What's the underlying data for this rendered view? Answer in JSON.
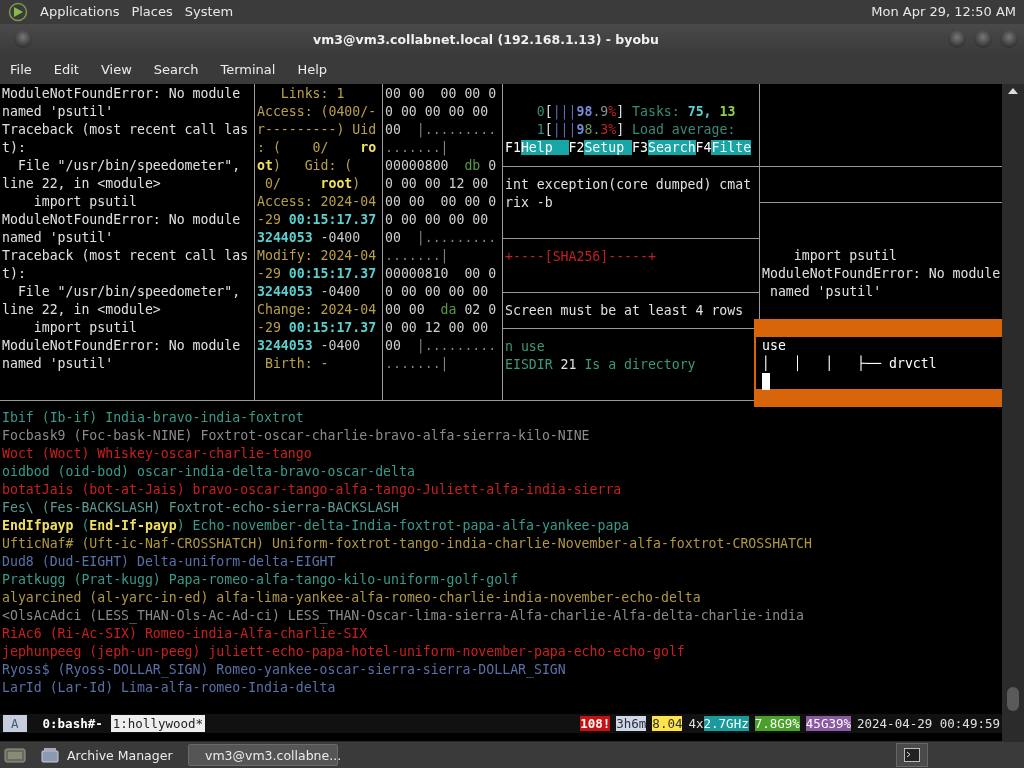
{
  "top_panel": {
    "menus": [
      "Applications",
      "Places",
      "System"
    ],
    "clock": "Mon Apr 29, 12:50 AM"
  },
  "window": {
    "title": "vm3@vm3.collabnet.local (192.168.1.13) - byobu",
    "menu": [
      "File",
      "Edit",
      "View",
      "Search",
      "Terminal",
      "Help"
    ]
  },
  "terminal": {
    "panes": [
      {
        "lines": [
          [
            {
              "text": "ModuleNotFoundError: No module",
              "color": "#e0e0e0"
            }
          ],
          [
            {
              "text": "named 'psutil'",
              "color": "#e0e0e0"
            }
          ],
          [
            {
              "text": "Traceback (most recent call las",
              "color": "#e0e0e0"
            }
          ],
          [
            {
              "text": "t):",
              "color": "#e0e0e0"
            }
          ],
          [
            {
              "text": "  File \"/usr/bin/speedometer\",",
              "color": "#e0e0e0"
            }
          ],
          [
            {
              "text": "line 22, in <module>",
              "color": "#e0e0e0"
            }
          ],
          [
            {
              "text": "    import psutil",
              "color": "#e0e0e0"
            }
          ],
          [
            {
              "text": "ModuleNotFoundError: No module",
              "color": "#e0e0e0"
            }
          ],
          [
            {
              "text": "named 'psutil'",
              "color": "#e0e0e0"
            }
          ],
          [
            {
              "text": "Traceback (most recent call las",
              "color": "#e0e0e0"
            }
          ],
          [
            {
              "text": "t):",
              "color": "#e0e0e0"
            }
          ],
          [
            {
              "text": "  File \"/usr/bin/speedometer\",",
              "color": "#e0e0e0"
            }
          ],
          [
            {
              "text": "line 22, in <module>",
              "color": "#e0e0e0"
            }
          ],
          [
            {
              "text": "    import psutil",
              "color": "#e0e0e0"
            }
          ],
          [
            {
              "text": "ModuleNotFoundError: No module",
              "color": "#e0e0e0"
            }
          ],
          [
            {
              "text": "named 'psutil'",
              "color": "#e0e0e0"
            }
          ]
        ]
      },
      {
        "lines": [
          [
            {
              "text": "   Links: 1",
              "color": "#b8a04a"
            }
          ],
          [
            {
              "text": "Access: (0400/-",
              "color": "#b8a04a"
            }
          ],
          [
            {
              "text": "r---------) Uid",
              "color": "#b8a04a"
            }
          ],
          [
            {
              "text": ": (    0/    ",
              "color": "#b8a04a"
            },
            {
              "text": "ro",
              "color": "#f0e060",
              "bold": true
            }
          ],
          [
            {
              "text": "ot",
              "color": "#f0e060",
              "bold": true
            },
            {
              "text": ")   Gid: (",
              "color": "#b8a04a"
            }
          ],
          [
            {
              "text": " 0/     ",
              "color": "#b8a04a"
            },
            {
              "text": "root",
              "color": "#f0e060",
              "bold": true
            },
            {
              "text": ")",
              "color": "#b8a04a"
            }
          ],
          [
            {
              "text": "Access: 2024-04",
              "color": "#b8a04a"
            }
          ],
          [
            {
              "text": "-29 ",
              "color": "#b8a04a"
            },
            {
              "text": "00:15:17.37",
              "color": "#5ccfcf",
              "bold": true
            }
          ],
          [
            {
              "text": "3244053",
              "color": "#5ccfcf",
              "bold": true
            },
            {
              "text": " -0400",
              "color": "#c8c8c8"
            }
          ],
          [
            {
              "text": "Modify: 2024-04",
              "color": "#b8a04a"
            }
          ],
          [
            {
              "text": "-29 ",
              "color": "#b8a04a"
            },
            {
              "text": "00:15:17.37",
              "color": "#5ccfcf",
              "bold": true
            }
          ],
          [
            {
              "text": "3244053",
              "color": "#5ccfcf",
              "bold": true
            },
            {
              "text": " -0400",
              "color": "#c8c8c8"
            }
          ],
          [
            {
              "text": "Change: 2024-04",
              "color": "#b8a04a"
            }
          ],
          [
            {
              "text": "-29 ",
              "color": "#b8a04a"
            },
            {
              "text": "00:15:17.37",
              "color": "#5ccfcf",
              "bold": true
            }
          ],
          [
            {
              "text": "3244053",
              "color": "#5ccfcf",
              "bold": true
            },
            {
              "text": " -0400",
              "color": "#c8c8c8"
            }
          ],
          [
            {
              "text": " Birth: -",
              "color": "#b8a04a"
            }
          ]
        ]
      },
      {
        "lines": [
          [
            {
              "text": "00 00  00 00 0",
              "color": "#d0d0d0"
            }
          ],
          [
            {
              "text": "0 00 00 00 00",
              "color": "#d0d0d0"
            }
          ],
          [
            {
              "text": "00  ",
              "color": "#d0d0d0"
            },
            {
              "text": "|.........",
              "color": "#808080"
            }
          ],
          [
            {
              "text": ".......|",
              "color": "#808080"
            }
          ],
          [
            {
              "text": "00000800  ",
              "color": "#d0d0d0"
            },
            {
              "text": "db",
              "color": "#5a9a4a"
            },
            {
              "text": " 0",
              "color": "#d0d0d0"
            }
          ],
          [
            {
              "text": "0 00 00 12 00",
              "color": "#d0d0d0"
            }
          ],
          [
            {
              "text": "00 00  00 00 0",
              "color": "#d0d0d0"
            }
          ],
          [
            {
              "text": "0 00 00 00 00",
              "color": "#d0d0d0"
            }
          ],
          [
            {
              "text": "00  ",
              "color": "#d0d0d0"
            },
            {
              "text": "|.........",
              "color": "#808080"
            }
          ],
          [
            {
              "text": ".......|",
              "color": "#808080"
            }
          ],
          [
            {
              "text": "00000810  00 0",
              "color": "#d0d0d0"
            }
          ],
          [
            {
              "text": "0 00 00 00 00",
              "color": "#d0d0d0"
            }
          ],
          [
            {
              "text": "00 00  ",
              "color": "#d0d0d0"
            },
            {
              "text": "da",
              "color": "#5a9a4a"
            },
            {
              "text": " 02 0",
              "color": "#d0d0d0"
            }
          ],
          [
            {
              "text": "0 00 12 00 00",
              "color": "#d0d0d0"
            }
          ],
          [
            {
              "text": "00  ",
              "color": "#d0d0d0"
            },
            {
              "text": "|.........",
              "color": "#808080"
            }
          ],
          [
            {
              "text": ".......|",
              "color": "#808080"
            }
          ]
        ]
      },
      {
        "sections": [
          {
            "lines": [
              [
                {
                  "text": "    0",
                  "color": "#3a8a7a"
                },
                {
                  "text": "[",
                  "color": "#e0e0e0"
                },
                {
                  "text": "|||",
                  "color": "#5a6ab8"
                },
                {
                  "text": "98",
                  "color": "#7a8ad8",
                  "bold": true
                },
                {
                  "text": ".9",
                  "color": "#909090"
                },
                {
                  "text": "%",
                  "color": "#c02020"
                },
                {
                  "text": "]",
                  "color": "#e0e0e0"
                },
                {
                  "text": " Tasks: ",
                  "color": "#3a8a7a"
                },
                {
                  "text": "75,",
                  "color": "#5ccfcf",
                  "bold": true
                },
                {
                  "text": " 13",
                  "color": "#90d050",
                  "bold": true
                }
              ],
              [
                {
                  "text": "    1",
                  "color": "#3a8a7a"
                },
                {
                  "text": "[",
                  "color": "#e0e0e0"
                },
                {
                  "text": "|||",
                  "color": "#5a6ab8"
                },
                {
                  "text": "9",
                  "color": "#7a8ad8",
                  "bold": true
                },
                {
                  "text": "8.",
                  "color": "#6a9a6a"
                },
                {
                  "text": "3%",
                  "color": "#c02020"
                },
                {
                  "text": "]",
                  "color": "#e0e0e0"
                },
                {
                  "text": " Load average:",
                  "color": "#3a8a7a"
                }
              ],
              [
                {
                  "text": "F1",
                  "color": "#ffffff"
                },
                {
                  "text": "Help  ",
                  "kind": "chip",
                  "color": "#17a5a5"
                },
                {
                  "text": "F2",
                  "color": "#ffffff"
                },
                {
                  "text": "Setup ",
                  "kind": "chip",
                  "color": "#17a5a5"
                },
                {
                  "text": "F3",
                  "color": "#ffffff"
                },
                {
                  "text": "Search",
                  "kind": "chip",
                  "color": "#17a5a5"
                },
                {
                  "text": "F4",
                  "color": "#ffffff"
                },
                {
                  "text": "Filte",
                  "kind": "chip",
                  "color": "#17a5a5"
                }
              ]
            ]
          },
          {
            "lines": [
              [
                {
                  "text": "int exception(core dumped) cmat",
                  "color": "#e0e0e0"
                }
              ],
              [
                {
                  "text": "rix -b",
                  "color": "#e0e0e0"
                }
              ]
            ]
          },
          {
            "lines": [
              [
                {
                  "text": "+----[SHA256]-----+",
                  "color": "#c02020"
                }
              ]
            ]
          },
          {
            "lines": [
              [
                {
                  "text": "Screen must be at least 4 rows",
                  "color": "#e0e0e0"
                }
              ]
            ]
          },
          {
            "lines": [
              [
                {
                  "text": "n use",
                  "color": "#3a9a7a"
                }
              ],
              [
                {
                  "text": "EISDIR",
                  "color": "#3a9a7a"
                },
                {
                  "text": " 21 ",
                  "color": "#e0e0e0"
                },
                {
                  "text": "Is a directory",
                  "color": "#3a9a7a"
                }
              ]
            ]
          }
        ]
      },
      {
        "lines": [
          [
            {
              "text": "    import psutil",
              "color": "#e0e0e0"
            }
          ],
          [
            {
              "text": "ModuleNotFoundError: No module",
              "color": "#e0e0e0"
            }
          ],
          [
            {
              "text": " named 'psutil'",
              "color": "#e0e0e0"
            }
          ]
        ],
        "popup": {
          "lines": [
            [
              {
                "text": "use",
                "color": "#ffffff"
              }
            ],
            [
              {
                "text": "│   │   │   ├── drvctl",
                "color": "#ffffff"
              }
            ]
          ]
        }
      }
    ],
    "output": [
      [
        {
          "text": "Ibif (Ib-if) India-bravo-india-foxtrot",
          "color": "#3a9a8a"
        }
      ],
      [
        {
          "text": "Focbask9 (Foc-bask-NINE) Foxtrot-oscar-charlie-bravo-alfa-sierra-kilo-NINE",
          "color": "#8a8a8a"
        }
      ],
      [
        {
          "text": "Woct (Woct) Whiskey-oscar-charlie-tango",
          "color": "#c82020"
        }
      ],
      [
        {
          "text": "oidbod (oid-bod) oscar-india-delta-bravo-oscar-delta",
          "color": "#3a9a8a"
        }
      ],
      [
        {
          "text": "botatJais (bot-at-Jais) bravo-oscar-tango-alfa-tango-Juliett-alfa-india-sierra",
          "color": "#c82020"
        }
      ],
      [
        {
          "text": "Fes\\ (Fes-BACKSLASH) Foxtrot-echo-sierra-BACKSLASH",
          "color": "#5a9a90"
        }
      ],
      [
        {
          "text": "EndIfpayp",
          "color": "#f0e060",
          "bold": true
        },
        {
          "text": " (",
          "color": "#3a9a8a"
        },
        {
          "text": "End-If-payp",
          "color": "#f0e060",
          "bold": true
        },
        {
          "text": ") Echo-november-delta-India-foxtrot-papa-alfa-yankee-papa",
          "color": "#3a9a8a"
        }
      ],
      [
        {
          "text": "UfticNaf# (Uft-ic-Naf-CROSSHATCH) Uniform-foxtrot-tango-india-charlie-November-alfa-foxtrot-CROSSHATCH",
          "color": "#b09840"
        }
      ],
      [
        {
          "text": "Dud8 (Dud-EIGHT) Delta-uniform-delta-EIGHT",
          "color": "#5a70a8"
        }
      ],
      [
        {
          "text": "Pratkugg (Prat-kugg) Papa-romeo-alfa-tango-kilo-uniform-golf-golf",
          "color": "#3a9a8a"
        }
      ],
      [
        {
          "text": "alyarcined (al-yarc-in-ed) alfa-lima-yankee-alfa-romeo-charlie-india-november-echo-delta",
          "color": "#b09840"
        }
      ],
      [
        {
          "text": "<OlsAcAdci (LESS_THAN-Ols-Ac-Ad-ci) LESS_THAN-Oscar-lima-sierra-Alfa-charlie-Alfa-delta-charlie-india",
          "color": "#8a8a8a"
        }
      ],
      [
        {
          "text": "RiAc6 (Ri-Ac-SIX) Romeo-india-Alfa-charlie-SIX",
          "color": "#c82020"
        }
      ],
      [
        {
          "text": "jephunpeeg (jeph-un-peeg) juliett-echo-papa-hotel-uniform-november-papa-echo-echo-golf",
          "color": "#c82020"
        }
      ],
      [
        {
          "text": "Ryoss$ (Ryoss-DOLLAR_SIGN) Romeo-yankee-oscar-sierra-sierra-DOLLAR_SIGN",
          "color": "#5a70a8"
        }
      ],
      [
        {
          "text": "LarId (Lar-Id) Lima-alfa-romeo-India-delta",
          "color": "#5a70a8"
        }
      ]
    ],
    "status": {
      "session": "A",
      "windows": [
        {
          "label": "0:bash#-",
          "selected": false
        },
        {
          "label": "1:hollywood*",
          "selected": true
        }
      ],
      "items": [
        [
          {
            "text": "108!",
            "kind": "chip",
            "color": "#c81010",
            "bold": true
          }
        ],
        [
          {
            "text": "3h6m",
            "kind": "chip",
            "color": "#d0d8e8"
          }
        ],
        [
          {
            "text": "8.04",
            "kind": "chip",
            "color": "#ffe34a"
          }
        ],
        [
          {
            "text": "4x",
            "color": "#e0e0e0"
          },
          {
            "text": "2.7GHz",
            "kind": "chip",
            "color": "#1a9a9a"
          }
        ],
        [
          {
            "text": "7.8G9%",
            "kind": "chip",
            "color": "#4aa02a"
          }
        ],
        [
          {
            "text": "45G39%",
            "kind": "chip",
            "color": "#8a5aa0"
          }
        ],
        [
          {
            "text": "2024-04-29 00:49:59",
            "color": "#e0e0e0"
          }
        ]
      ]
    }
  },
  "taskbar": {
    "buttons": [
      {
        "label": "Archive Manager",
        "selected": false
      },
      {
        "label": "vm3@vm3.collabne...",
        "selected": true
      }
    ]
  }
}
